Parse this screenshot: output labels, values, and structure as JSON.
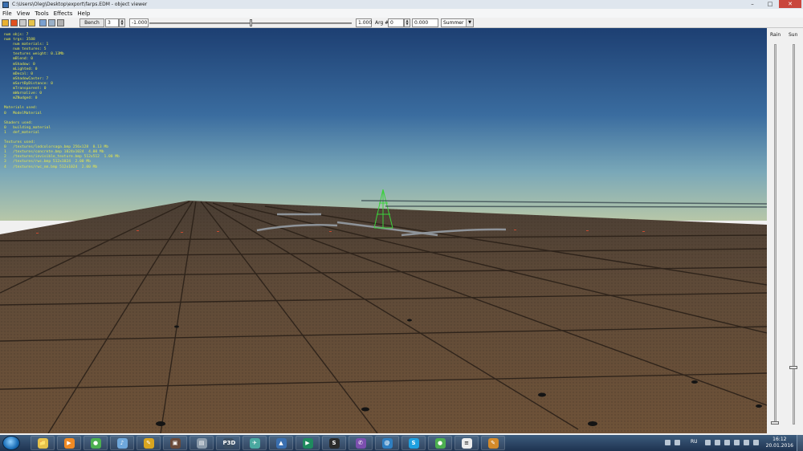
{
  "window": {
    "title": "C:\\Users\\Oleg\\Desktop\\export\\farps.EDM - object viewer",
    "controls": {
      "minimize": "–",
      "maximize": "□",
      "close": "✕"
    }
  },
  "menu": [
    "File",
    "View",
    "Tools",
    "Effects",
    "Help"
  ],
  "toolbar": {
    "icons": [
      "open-icon",
      "fire-icon",
      "recent-icon",
      "folder-icon",
      "pause-icon",
      "grid-icon",
      "stop-icon"
    ],
    "bench_label": "Bench",
    "bench_value": "3",
    "arg_min": "-1.000",
    "arg_max": "1.000",
    "arg_label": "Arg #",
    "arg_index": "0",
    "arg_value": "0.000",
    "arg_slider_fraction": 0.5,
    "season": "Summer"
  },
  "stats": [
    "num objs: 7",
    "num trgs: 3588",
    "    num materials: 1",
    "    num textures: 5",
    "    textures weight: 0.13Mb",
    "    mBlend: 0",
    "    mShadow: 0",
    "    mLighted: 0",
    "    mDecal: 0",
    "    mShadowCaster: 7",
    "    mSortByDistance: 0",
    "    mTransparent: 0",
    "    mWarnalive: 0",
    "    mZNudged: 0",
    "",
    "Materials used:",
    "0   ModelMaterial",
    "",
    "Shaders used:",
    "0   building_material",
    "1   def_material",
    "",
    "Textures used:",
    "0   /textures/lodcolorsaga.bmp 256x128  0.13 Mb",
    "1   /textures/concrete.bmp 1024x1024  4.00 Mb",
    "2   /textures/invisible_texture.bmp 512x512  1.00 Mb",
    "3   /textures/rwc.bmp 512x1024  2.00 Mb",
    "4   /textures/rwc_nm.bmp 512x1024  2.00 Mb"
  ],
  "side_panel": {
    "rain_label": "Rain",
    "sun_label": "Sun",
    "rain_level": 0.0,
    "sun_level": 0.15
  },
  "taskbar": {
    "apps": [
      {
        "name": "explorer",
        "glyph": "📁",
        "color": "#e6c24a"
      },
      {
        "name": "media-player",
        "glyph": "▶",
        "color": "#f08a24"
      },
      {
        "name": "chrome",
        "glyph": "●",
        "color": "#4caf50"
      },
      {
        "name": "speaker",
        "glyph": "♪",
        "color": "#6fa8dc"
      },
      {
        "name": "ruler-tool",
        "glyph": "✎",
        "color": "#d9a520"
      },
      {
        "name": "book-app",
        "glyph": "▣",
        "color": "#6a4a3a"
      },
      {
        "name": "photo-app",
        "glyph": "▤",
        "color": "#8a9aaa"
      },
      {
        "name": "p3d-app",
        "glyph": "P3D",
        "color": "#3c4f63"
      },
      {
        "name": "plane-app",
        "glyph": "✈",
        "color": "#4aa8a0"
      },
      {
        "name": "navigator-app",
        "glyph": "▲",
        "color": "#3a6fb0"
      },
      {
        "name": "terminal-app",
        "glyph": "▶",
        "color": "#1f8a5e"
      },
      {
        "name": "sublime-app",
        "glyph": "S",
        "color": "#2b2b2b"
      },
      {
        "name": "viber",
        "glyph": "✆",
        "color": "#7b4fae"
      },
      {
        "name": "browser-e",
        "glyph": "@",
        "color": "#2f7fc1"
      },
      {
        "name": "skype",
        "glyph": "S",
        "color": "#1ea0e0"
      },
      {
        "name": "chrome-2",
        "glyph": "●",
        "color": "#4caf50"
      },
      {
        "name": "notepad",
        "glyph": "≡",
        "color": "#ededed"
      },
      {
        "name": "paint",
        "glyph": "✎",
        "color": "#d48a2a"
      }
    ],
    "lang": "RU",
    "time": "16:12",
    "date": "20.01.2016"
  }
}
